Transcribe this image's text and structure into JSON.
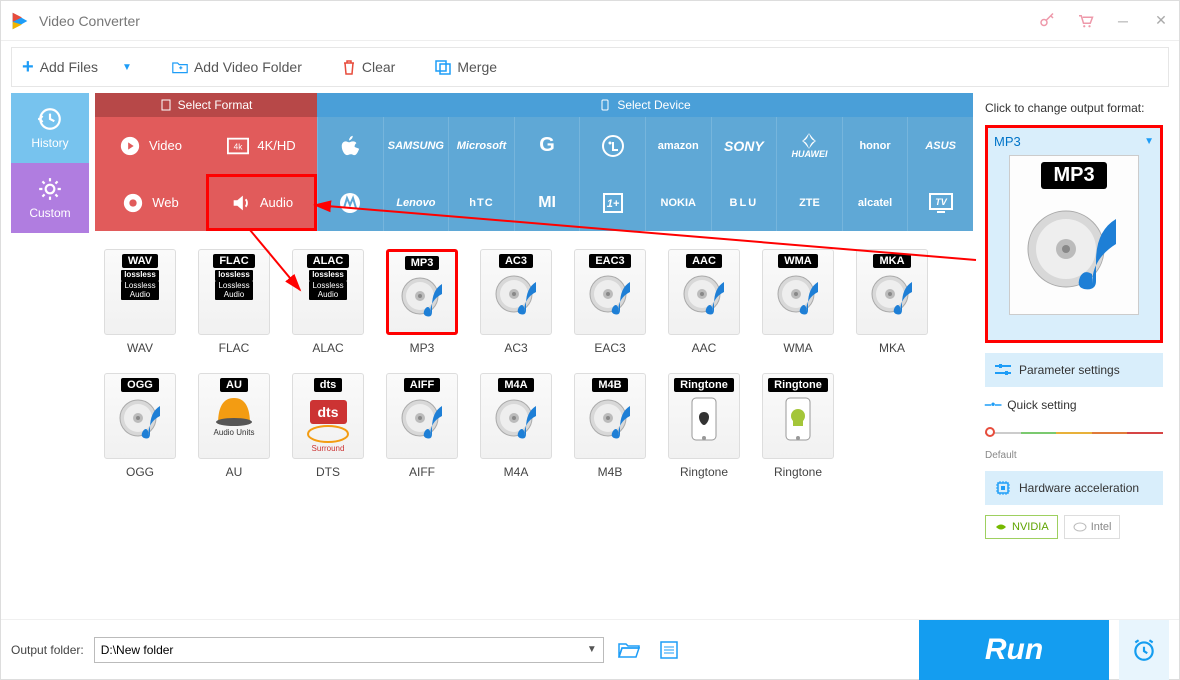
{
  "titlebar": {
    "title": "Video Converter"
  },
  "toolbar": {
    "add_files": "Add Files",
    "add_folder": "Add Video Folder",
    "clear": "Clear",
    "merge": "Merge"
  },
  "sidebar": {
    "history": "History",
    "custom": "Custom"
  },
  "cat_header": {
    "select_format": "Select Format",
    "select_device": "Select Device"
  },
  "categories": {
    "video": "Video",
    "fourk": "4K/HD",
    "web": "Web",
    "audio": "Audio"
  },
  "brands_row1": [
    "Apple",
    "SAMSUNG",
    "Microsoft",
    "G",
    "LG",
    "amazon",
    "SONY",
    "HUAWEI",
    "honor",
    "ASUS"
  ],
  "brands_row2": [
    "Moto",
    "Lenovo",
    "hTC",
    "MI",
    "OnePlus",
    "NOKIA",
    "BLU",
    "ZTE",
    "alcatel",
    "TV"
  ],
  "formats": [
    {
      "code": "WAV",
      "label": "WAV",
      "sub": "Lossless Audio",
      "lossless": true
    },
    {
      "code": "FLAC",
      "label": "FLAC",
      "sub": "Lossless Audio",
      "lossless": true
    },
    {
      "code": "ALAC",
      "label": "ALAC",
      "sub": "Lossless Audio",
      "lossless": true
    },
    {
      "code": "MP3",
      "label": "MP3",
      "selected": true
    },
    {
      "code": "AC3",
      "label": "AC3"
    },
    {
      "code": "EAC3",
      "label": "EAC3"
    },
    {
      "code": "AAC",
      "label": "AAC"
    },
    {
      "code": "WMA",
      "label": "WMA"
    },
    {
      "code": "MKA",
      "label": "MKA"
    },
    {
      "code": "OGG",
      "label": "OGG"
    },
    {
      "code": "AU",
      "label": "AU",
      "sub": "Audio Units",
      "au": true
    },
    {
      "code": "dts",
      "label": "DTS",
      "sub": "Surround",
      "dts": true
    },
    {
      "code": "AIFF",
      "label": "AIFF"
    },
    {
      "code": "M4A",
      "label": "M4A"
    },
    {
      "code": "M4B",
      "label": "M4B"
    },
    {
      "code": "Ringtone",
      "label": "Ringtone",
      "ring": "apple"
    },
    {
      "code": "Ringtone",
      "label": "Ringtone",
      "ring": "android"
    }
  ],
  "right": {
    "change_label": "Click to change output format:",
    "output_code": "MP3",
    "parameter_settings": "Parameter settings",
    "quick_setting": "Quick setting",
    "slider_default": "Default",
    "hardware_accel": "Hardware acceleration",
    "nvidia": "NVIDIA",
    "intel": "Intel"
  },
  "bottom": {
    "output_folder_label": "Output folder:",
    "output_folder_value": "D:\\New folder",
    "run": "Run"
  }
}
